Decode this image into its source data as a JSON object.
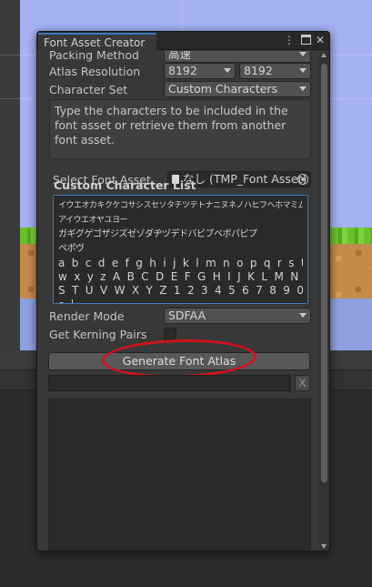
{
  "window": {
    "title": "Font Asset Creator",
    "menu_icon": "kebab-menu-icon",
    "maximize_icon": "maximize-icon",
    "close_icon": "close-icon"
  },
  "form": {
    "packing_method": {
      "label": "Packing Method",
      "value": "高速"
    },
    "atlas_resolution": {
      "label": "Atlas Resolution",
      "width": "8192",
      "height": "8192"
    },
    "character_set": {
      "label": "Character Set",
      "value": "Custom Characters"
    },
    "help_text": "Type the characters to be included in the font asset or retrieve them from another font asset.",
    "select_font_asset": {
      "label": "Select Font Asset",
      "value": "なし (TMP_Font Asset)"
    },
    "custom_character_list": {
      "label": "Custom Character List",
      "lines": [
        "イウエオカキクケコサシスセソタチツテトナニヌネノハヒフヘホマミムメモヤユヨラリルレロワヲン",
        "アイウエオヤユヨー",
        "ガギグゲゴザジズゼゾダヂヅデドバビブベボパピプ",
        "ペポヴ",
        "a b c d e f g h i j k l m n o p q r s t u v",
        "w x y z A B C D E F G H I J K L M N O P Q R",
        "S T U V W X Y Z 1 2 3 4 5 6 7 8 9 0",
        "～"
      ]
    },
    "render_mode": {
      "label": "Render Mode",
      "value": "SDFAA"
    },
    "get_kerning_pairs": {
      "label": "Get Kerning Pairs",
      "checked": false
    }
  },
  "actions": {
    "generate_label": "Generate Font Atlas",
    "clear_label": "X"
  },
  "colors": {
    "annotation": "#d0141c",
    "accent": "#3a79bb"
  }
}
